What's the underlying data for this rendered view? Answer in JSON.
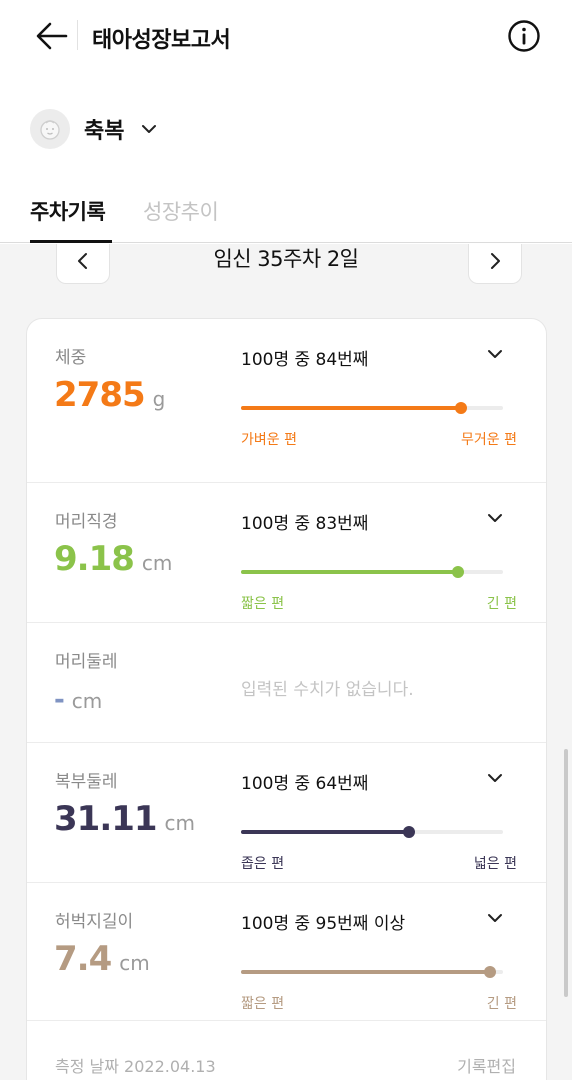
{
  "header": {
    "title": "태아성장보고서"
  },
  "baby": {
    "name": "축복"
  },
  "tabs": [
    {
      "label": "주차기록",
      "active": true
    },
    {
      "label": "성장추이",
      "active": false
    }
  ],
  "week": {
    "label": "임신 35주차 2일"
  },
  "metrics": [
    {
      "label": "체중",
      "value": "2785",
      "unit": "g",
      "rank": "100명 중 84번째",
      "percentile": 84,
      "low_label": "가벼운 편",
      "high_label": "무거운 편",
      "color": "#f47a17"
    },
    {
      "label": "머리직경",
      "value": "9.18",
      "unit": "cm",
      "rank": "100명 중 83번째",
      "percentile": 83,
      "low_label": "짧은 편",
      "high_label": "긴 편",
      "color": "#8bc34a"
    },
    {
      "label": "머리둘레",
      "value": "-",
      "unit": "cm",
      "empty_text": "입력된 수치가 없습니다.",
      "color": "#7f93c2"
    },
    {
      "label": "복부둘레",
      "value": "31.11",
      "unit": "cm",
      "rank": "100명 중 64번째",
      "percentile": 64,
      "low_label": "좁은 편",
      "high_label": "넓은 편",
      "color": "#3b3656"
    },
    {
      "label": "허벅지길이",
      "value": "7.4",
      "unit": "cm",
      "rank": "100명 중 95번째 이상",
      "percentile": 95,
      "low_label": "짧은 편",
      "high_label": "긴 편",
      "color": "#b59b82"
    }
  ],
  "footer": {
    "date_label": "측정 날짜 2022.04.13",
    "edit_label": "기록편집"
  }
}
